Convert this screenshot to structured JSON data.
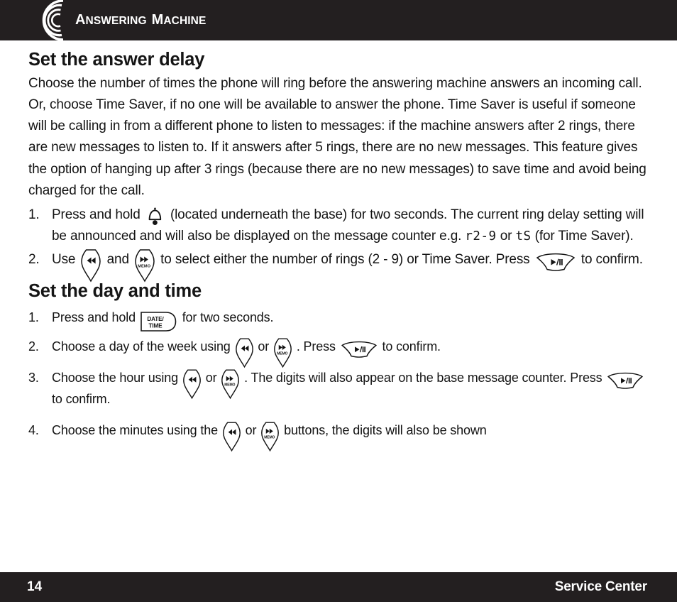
{
  "header": {
    "logo_icon": "concentric-sound-waves-logo",
    "title_first_cap": "A",
    "title_first_rest": "NSWERING",
    "title_second_cap": "M",
    "title_second_rest": "ACHINE",
    "title_full": "ANSWERING MACHINE",
    "background_color": "#231f20",
    "text_color": "#ffffff"
  },
  "sections": [
    {
      "title": "Set the answer delay",
      "intro": "Choose the number of times the phone will ring before the answering machine answers an incoming call. Or, choose Time Saver, if no one will be available to answer the phone. Time Saver is useful if someone will be calling in from a different phone to listen to messages: if the machine answers after 2 rings, there are new messages to listen to. If it answers after 5 rings, there are no new messages. This feature gives the option of hanging up after 3 rings (because there are no new messages) to save time and avoid being charged for the call.",
      "steps": [
        {
          "number": "1.",
          "part1": "Press and hold",
          "part2": "(located underneath the base) for two seconds. The current ring delay setting will be announced and will also be displayed on the message counter e.g.",
          "lcd1": "r2-9",
          "part3": "or",
          "lcd2": "tS",
          "part4": "(for Time Saver)."
        },
        {
          "number": "2.",
          "part1": "Use",
          "part2": "and",
          "part3": "to select either the number of rings (2 - 9) or Time Saver. Press",
          "part4": "to confirm."
        }
      ]
    },
    {
      "title": "Set the day and time",
      "steps": [
        {
          "number": "1.",
          "part1": "Press and hold",
          "part2": "for two seconds."
        },
        {
          "number": "2.",
          "part1": "Choose a day of the week using",
          "part2": "or",
          "part3": ". Press",
          "part4": "to confirm."
        },
        {
          "number": "3.",
          "part1": "Choose the hour using",
          "part2": "or",
          "part3": ". The digits will also appear on the base message counter. Press",
          "part4": "to confirm."
        },
        {
          "number": "4.",
          "part1": "Choose the minutes using the",
          "part2": "or",
          "part3": "buttons, the digits will also be shown"
        }
      ]
    }
  ],
  "buttons": {
    "rewind_label": "◄◄",
    "forward_label": "►►",
    "memo_label": "MEMO",
    "play_pause_label": "►/II",
    "date_label": "DATE/",
    "time_label": "TIME",
    "bell_icon": "bell-icon"
  },
  "footer": {
    "page_number": "14",
    "brand": "Service Center",
    "background_color": "#231f20",
    "text_color": "#ffffff"
  }
}
